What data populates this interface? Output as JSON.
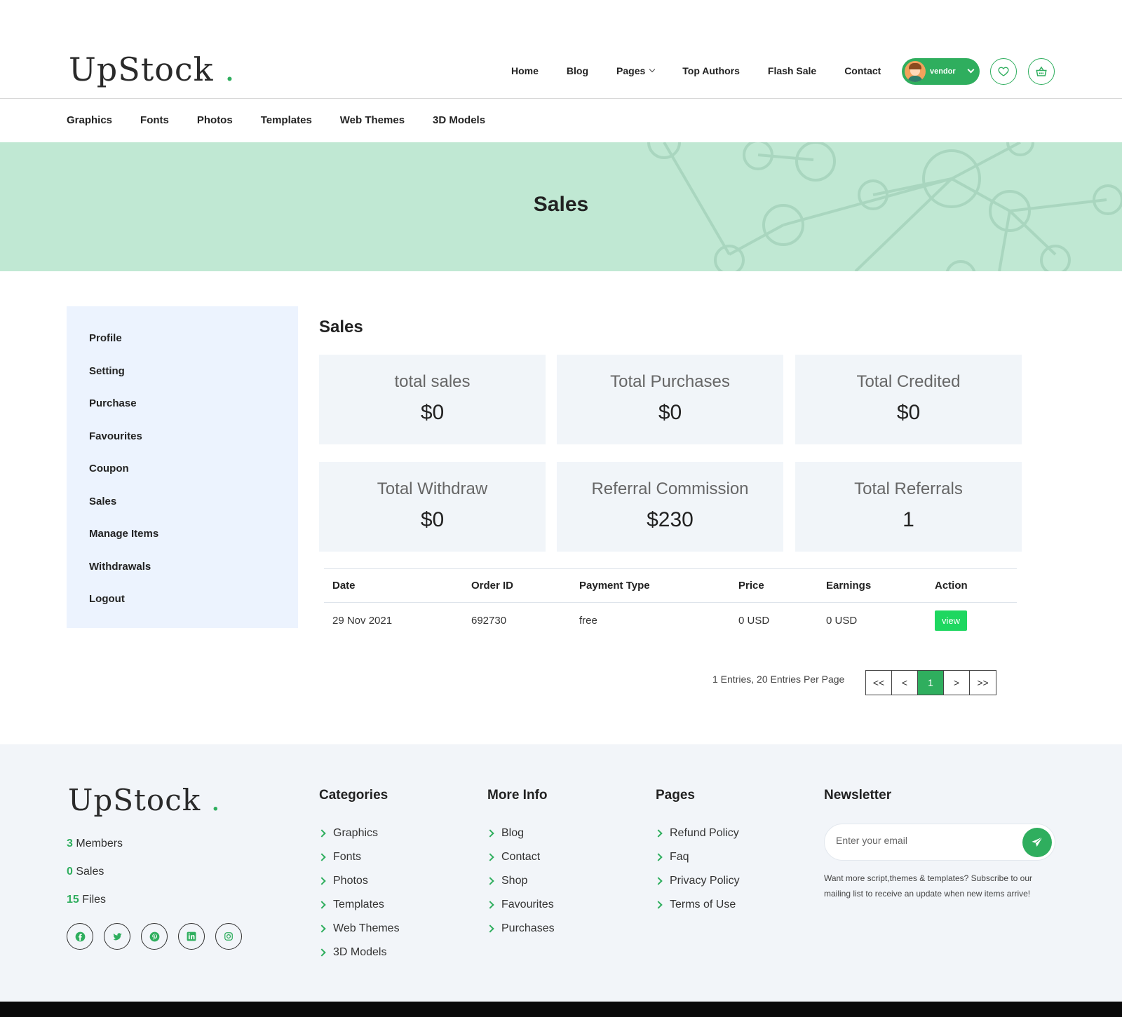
{
  "brand": {
    "name": "UpStock",
    "dot": "."
  },
  "main_nav": [
    {
      "label": "Home"
    },
    {
      "label": "Blog"
    },
    {
      "label": "Pages"
    },
    {
      "label": "Top Authors"
    },
    {
      "label": "Flash Sale"
    },
    {
      "label": "Contact"
    }
  ],
  "user": {
    "name": "vendor"
  },
  "icons": {
    "wishlist": "heart-icon",
    "cart": "basket-icon"
  },
  "category_nav": [
    "Graphics",
    "Fonts",
    "Photos",
    "Templates",
    "Web Themes",
    "3D Models"
  ],
  "banner": {
    "title": "Sales"
  },
  "sidebar": {
    "items": [
      "Profile",
      "Setting",
      "Purchase",
      "Favourites",
      "Coupon",
      "Sales",
      "Manage Items",
      "Withdrawals",
      "Logout"
    ]
  },
  "content": {
    "title": "Sales",
    "stats": [
      {
        "label": "total sales",
        "value": "$0"
      },
      {
        "label": "Total Purchases",
        "value": "$0"
      },
      {
        "label": "Total Credited",
        "value": "$0"
      },
      {
        "label": "Total Withdraw",
        "value": "$0"
      },
      {
        "label": "Referral Commission",
        "value": "$230"
      },
      {
        "label": "Total Referrals",
        "value": "1"
      }
    ],
    "table": {
      "headers": [
        "Date",
        "Order ID",
        "Payment Type",
        "Price",
        "Earnings",
        "Action"
      ],
      "rows": [
        {
          "date": "29 Nov 2021",
          "order_id": "692730",
          "payment_type": "free",
          "price": "0 USD",
          "earnings": "0 USD",
          "action": "view"
        }
      ]
    },
    "pagination": {
      "summary": "1 Entries, 20 Entries Per Page",
      "first": "<<",
      "prev": "<",
      "current": "1",
      "next": ">",
      "last": ">>"
    }
  },
  "footer": {
    "stats": [
      {
        "num": "3",
        "label": "Members"
      },
      {
        "num": "0",
        "label": "Sales"
      },
      {
        "num": "15",
        "label": "Files"
      }
    ],
    "social": [
      "facebook-icon",
      "twitter-icon",
      "pinterest-icon",
      "linkedin-icon",
      "instagram-icon"
    ],
    "categories": {
      "title": "Categories",
      "links": [
        "Graphics",
        "Fonts",
        "Photos",
        "Templates",
        "Web Themes",
        "3D Models"
      ]
    },
    "more_info": {
      "title": "More Info",
      "links": [
        "Blog",
        "Contact",
        "Shop",
        "Favourites",
        "Purchases"
      ]
    },
    "pages": {
      "title": "Pages",
      "links": [
        "Refund Policy",
        "Faq",
        "Privacy Policy",
        "Terms of Use"
      ]
    },
    "newsletter": {
      "title": "Newsletter",
      "placeholder": "Enter your email",
      "note": "Want more script,themes & templates? Subscribe to our mailing list to receive an update when new items arrive!"
    }
  },
  "colors": {
    "accent": "#2fae5e",
    "banner_bg": "#c0e8d3",
    "sidebar_bg": "#ecf3fe",
    "card_bg": "#f1f5f9",
    "footer_bg": "#f2f5f9",
    "view_button": "#1ed760"
  }
}
